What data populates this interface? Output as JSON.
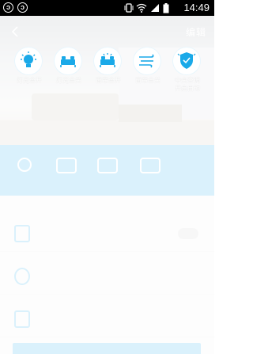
{
  "status_bar": {
    "time": "14:49",
    "left_icons": [
      "circle-notification-icon",
      "circle-notification-icon"
    ],
    "right_icons": [
      "vibrate-icon",
      "wifi-icon",
      "cellular-signal-icon",
      "battery-icon"
    ]
  },
  "header": {
    "back_icon": "chevron-left-icon",
    "edit_label": "编辑"
  },
  "scenes": [
    {
      "label": "灯光全开",
      "icon": "bulb-on-icon"
    },
    {
      "label": "灯光全关",
      "icon": "bed-light-off-icon"
    },
    {
      "label": "窗帘全开",
      "icon": "curtain-open-icon"
    },
    {
      "label": "窗帘全关",
      "icon": "curtain-close-icon"
    },
    {
      "label_line1": "中央空调",
      "label_line2": "开启自动",
      "icon": "ac-shield-icon"
    }
  ],
  "colors": {
    "accent": "#1aa9e8",
    "overlay": "#ffffff",
    "status_bar": "#000000"
  }
}
